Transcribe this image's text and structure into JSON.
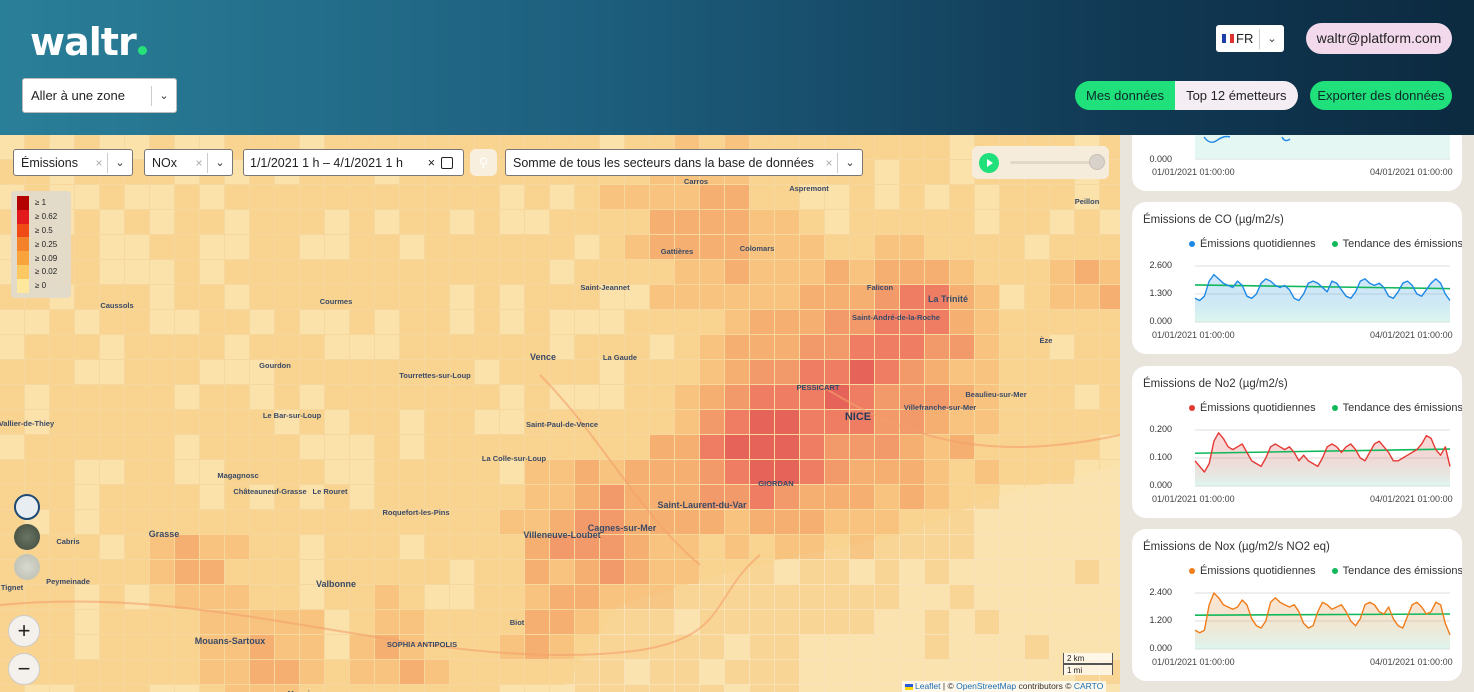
{
  "header": {
    "logo_text": "waltr",
    "zone_select": "Aller à une zone",
    "language": "FR",
    "user_email": "waltr@platform.com",
    "toggle_my_data": "Mes données",
    "toggle_top": "Top 12 émetteurs",
    "export_button": "Exporter des données"
  },
  "filters": {
    "type": "Émissions",
    "pollutant": "NOx",
    "date_range": "1/1/2021 1 h – 4/1/2021 1 h",
    "sector": "Somme de tous les secteurs dans la base de données"
  },
  "legend": {
    "items": [
      {
        "label": "≥ 1",
        "color": "#b30000"
      },
      {
        "label": "≥ 0.62",
        "color": "#e31a1c"
      },
      {
        "label": "≥ 0.5",
        "color": "#f04a16"
      },
      {
        "label": "≥ 0.25",
        "color": "#f3822a"
      },
      {
        "label": "≥ 0.09",
        "color": "#f8a33b"
      },
      {
        "label": "≥ 0.02",
        "color": "#fcc862"
      },
      {
        "label": "≥ 0",
        "color": "#fde89b"
      }
    ]
  },
  "map": {
    "labels": [
      {
        "text": "Carros",
        "cls": ""
      },
      {
        "text": "Aspremont",
        "cls": ""
      },
      {
        "text": "Peillon",
        "cls": ""
      },
      {
        "text": "Colomars",
        "cls": ""
      },
      {
        "text": "Gattières",
        "cls": ""
      },
      {
        "text": "Saint-Jeannet",
        "cls": ""
      },
      {
        "text": "Falicon",
        "cls": ""
      },
      {
        "text": "Saint-André-de-la-Roche",
        "cls": ""
      },
      {
        "text": "La Trinité",
        "cls": "big"
      },
      {
        "text": "Caussols",
        "cls": ""
      },
      {
        "text": "Courmes",
        "cls": ""
      },
      {
        "text": "Èze",
        "cls": ""
      },
      {
        "text": "Vence",
        "cls": "big"
      },
      {
        "text": "La Gaude",
        "cls": ""
      },
      {
        "text": "Gourdon",
        "cls": ""
      },
      {
        "text": "Tourrettes-sur-Loup",
        "cls": ""
      },
      {
        "text": "PESSICART",
        "cls": ""
      },
      {
        "text": "Beaulieu-sur-Mer",
        "cls": ""
      },
      {
        "text": "Saint-Vallier-de-Thiey",
        "cls": ""
      },
      {
        "text": "Le Bar-sur-Loup",
        "cls": ""
      },
      {
        "text": "Saint-Paul-de-Vence",
        "cls": ""
      },
      {
        "text": "NICE",
        "cls": "city"
      },
      {
        "text": "Villefranche-sur-Mer",
        "cls": ""
      },
      {
        "text": "La Colle-sur-Loup",
        "cls": ""
      },
      {
        "text": "Magagnosc",
        "cls": ""
      },
      {
        "text": "Châteauneuf-Grasse",
        "cls": ""
      },
      {
        "text": "Le Rouret",
        "cls": ""
      },
      {
        "text": "GIORDAN",
        "cls": ""
      },
      {
        "text": "Roquefort-les-Pins",
        "cls": ""
      },
      {
        "text": "Saint-Laurent-du-Var",
        "cls": "big"
      },
      {
        "text": "Villeneuve-Loubet",
        "cls": "big"
      },
      {
        "text": "Cagnes-sur-Mer",
        "cls": "big"
      },
      {
        "text": "Cabris",
        "cls": ""
      },
      {
        "text": "Grasse",
        "cls": "big"
      },
      {
        "text": "Peymeinade",
        "cls": ""
      },
      {
        "text": "Valbonne",
        "cls": "big"
      },
      {
        "text": "Tignet",
        "cls": ""
      },
      {
        "text": "Biot",
        "cls": ""
      },
      {
        "text": "Mouans-Sartoux",
        "cls": "big"
      },
      {
        "text": "SOPHIA ANTIPOLIS",
        "cls": ""
      },
      {
        "text": "Mougins",
        "cls": ""
      }
    ],
    "scale_km": "2 km",
    "scale_mi": "1 mi",
    "attribution_leaflet": "Leaflet",
    "attribution_sep": " | © ",
    "attribution_osm": "OpenStreetMap",
    "attribution_mid": " contributors © ",
    "attribution_carto": "CARTO"
  },
  "charts": [
    {
      "id": "top",
      "title": "",
      "series_color": "#1e88e5",
      "trend_color": "#11b85a",
      "y_ticks": [
        "0.000"
      ],
      "x_start": "01/01/2021 01:00:00",
      "x_end": "04/01/2021 01:00:00"
    },
    {
      "id": "co",
      "title": "Émissions de CO (µg/m2/s)",
      "legend_daily": "Émissions quotidiennes",
      "legend_trend": "Tendance des émissions",
      "series_color": "#1e88e5",
      "trend_color": "#11b85a",
      "y_ticks": [
        "2.600",
        "1.300",
        "0.000"
      ],
      "x_start": "01/01/2021 01:00:00",
      "x_end": "04/01/2021 01:00:00"
    },
    {
      "id": "no2",
      "title": "Émissions de No2 (µg/m2/s)",
      "legend_daily": "Émissions quotidiennes",
      "legend_trend": "Tendance des émissions",
      "series_color": "#e53935",
      "trend_color": "#11b85a",
      "y_ticks": [
        "0.200",
        "0.100",
        "0.000"
      ],
      "x_start": "01/01/2021 01:00:00",
      "x_end": "04/01/2021 01:00:00"
    },
    {
      "id": "nox",
      "title": "Émissions de Nox (µg/m2/s NO2 eq)",
      "legend_daily": "Émissions quotidiennes",
      "legend_trend": "Tendance des émissions",
      "series_color": "#f07c1a",
      "trend_color": "#11b85a",
      "y_ticks": [
        "2.400",
        "1.200",
        "0.000"
      ],
      "x_start": "01/01/2021 01:00:00",
      "x_end": "04/01/2021 01:00:00"
    }
  ],
  "chart_data": [
    {
      "type": "line",
      "title": "Émissions de CO (µg/m2/s)",
      "ylim": [
        0,
        2.6
      ],
      "x_range": [
        "01/01/2021 01:00:00",
        "04/01/2021 01:00:00"
      ],
      "series": [
        {
          "name": "Émissions quotidiennes",
          "values": [
            1.1,
            1.0,
            1.2,
            1.9,
            2.2,
            2.0,
            1.8,
            1.7,
            1.6,
            1.9,
            1.7,
            1.2,
            1.1,
            1.3,
            1.8,
            2.0,
            1.9,
            1.7,
            1.6,
            1.7,
            1.5,
            1.1,
            1.0,
            1.3,
            1.8,
            1.9,
            1.8,
            1.6,
            1.4,
            1.9,
            1.8,
            1.5,
            1.2,
            1.1,
            1.4,
            1.9,
            2.0,
            1.8,
            1.7,
            1.8,
            1.6,
            1.2,
            1.1,
            1.4,
            1.8,
            1.9,
            1.7,
            1.3,
            1.2,
            1.5,
            1.8,
            2.0,
            1.8,
            1.3,
            1.0
          ]
        },
        {
          "name": "Tendance des émissions",
          "values": [
            1.72,
            1.55
          ]
        }
      ]
    },
    {
      "type": "line",
      "title": "Émissions de No2 (µg/m2/s)",
      "ylim": [
        0,
        0.2
      ],
      "x_range": [
        "01/01/2021 01:00:00",
        "04/01/2021 01:00:00"
      ],
      "series": [
        {
          "name": "Émissions quotidiennes",
          "values": [
            0.09,
            0.07,
            0.05,
            0.08,
            0.16,
            0.19,
            0.17,
            0.14,
            0.13,
            0.14,
            0.15,
            0.12,
            0.09,
            0.08,
            0.07,
            0.1,
            0.14,
            0.15,
            0.14,
            0.13,
            0.14,
            0.12,
            0.09,
            0.11,
            0.09,
            0.08,
            0.07,
            0.1,
            0.14,
            0.15,
            0.14,
            0.12,
            0.14,
            0.15,
            0.13,
            0.1,
            0.09,
            0.12,
            0.15,
            0.16,
            0.14,
            0.12,
            0.09,
            0.09,
            0.1,
            0.11,
            0.12,
            0.13,
            0.15,
            0.18,
            0.17,
            0.13,
            0.11,
            0.14,
            0.07
          ]
        },
        {
          "name": "Tendance des émissions",
          "values": [
            0.117,
            0.132
          ]
        }
      ]
    },
    {
      "type": "line",
      "title": "Émissions de Nox (µg/m2/s NO2 eq)",
      "ylim": [
        0,
        2.4
      ],
      "x_range": [
        "01/01/2021 01:00:00",
        "04/01/2021 01:00:00"
      ],
      "series": [
        {
          "name": "Émissions quotidiennes",
          "values": [
            0.8,
            0.7,
            0.8,
            1.9,
            2.4,
            2.2,
            1.9,
            1.8,
            1.7,
            1.8,
            2.1,
            1.9,
            1.3,
            1.0,
            0.9,
            1.2,
            2.0,
            2.2,
            2.0,
            1.9,
            1.8,
            1.9,
            1.6,
            1.1,
            0.9,
            1.0,
            1.6,
            2.0,
            1.9,
            1.7,
            1.8,
            1.9,
            1.6,
            1.2,
            1.0,
            1.3,
            1.9,
            2.0,
            1.9,
            1.6,
            1.5,
            1.8,
            1.3,
            1.0,
            0.9,
            1.4,
            1.9,
            2.0,
            1.8,
            1.5,
            1.6,
            2.0,
            1.9,
            1.1,
            0.6
          ]
        },
        {
          "name": "Tendance des émissions",
          "values": [
            1.45,
            1.5
          ]
        }
      ]
    }
  ]
}
